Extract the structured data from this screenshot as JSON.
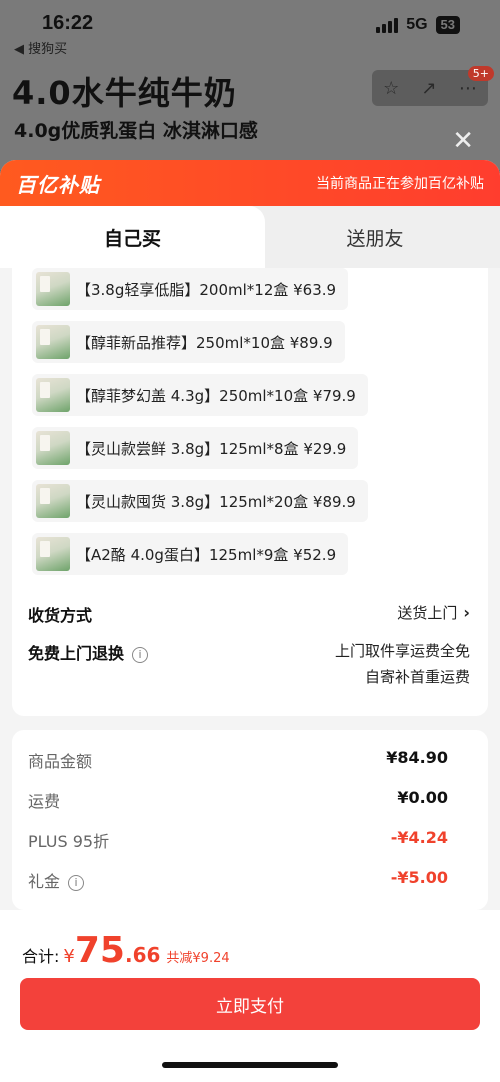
{
  "status_bar": {
    "time": "16:22",
    "back_label": "◀ 搜狗买",
    "network": "5G",
    "battery": "53"
  },
  "background": {
    "title": "4.0水牛纯牛奶",
    "subtitle": "4.0g优质乳蛋白 冰淇淋口感",
    "cart_badge": "5+"
  },
  "banner": {
    "logo": "百亿补贴",
    "note": "当前商品正在参加百亿补贴"
  },
  "tabs": {
    "self": "自己买",
    "friend": "送朋友"
  },
  "items": [
    "【3.8g轻享低脂】200ml*12盒  ¥63.9",
    "【醇菲新品推荐】250ml*10盒  ¥89.9",
    "【醇菲梦幻盖 4.3g】250ml*10盒  ¥79.9",
    "【灵山款尝鲜 3.8g】125ml*8盒  ¥29.9",
    "【灵山款囤货 3.8g】125ml*20盒  ¥89.9",
    "【A2酪 4.0g蛋白】125ml*9盒  ¥52.9"
  ],
  "delivery": {
    "label": "收货方式",
    "value": "送货上门"
  },
  "return": {
    "label": "免费上门退换",
    "line1": "上门取件享运费全免",
    "line2": "自寄补首重运费"
  },
  "price": {
    "goods_label": "商品金额",
    "goods_value": "¥84.90",
    "shipping_label": "运费",
    "shipping_value": "¥0.00",
    "plus_label": "PLUS 95折",
    "plus_value": "-¥4.24",
    "gift_label": "礼金",
    "gift_value": "-¥5.00"
  },
  "footer": {
    "total_label": "合计:",
    "currency": "¥",
    "total_int": "75",
    "total_dec": ".66",
    "saved": "共减¥9.24",
    "pay_button": "立即支付"
  }
}
